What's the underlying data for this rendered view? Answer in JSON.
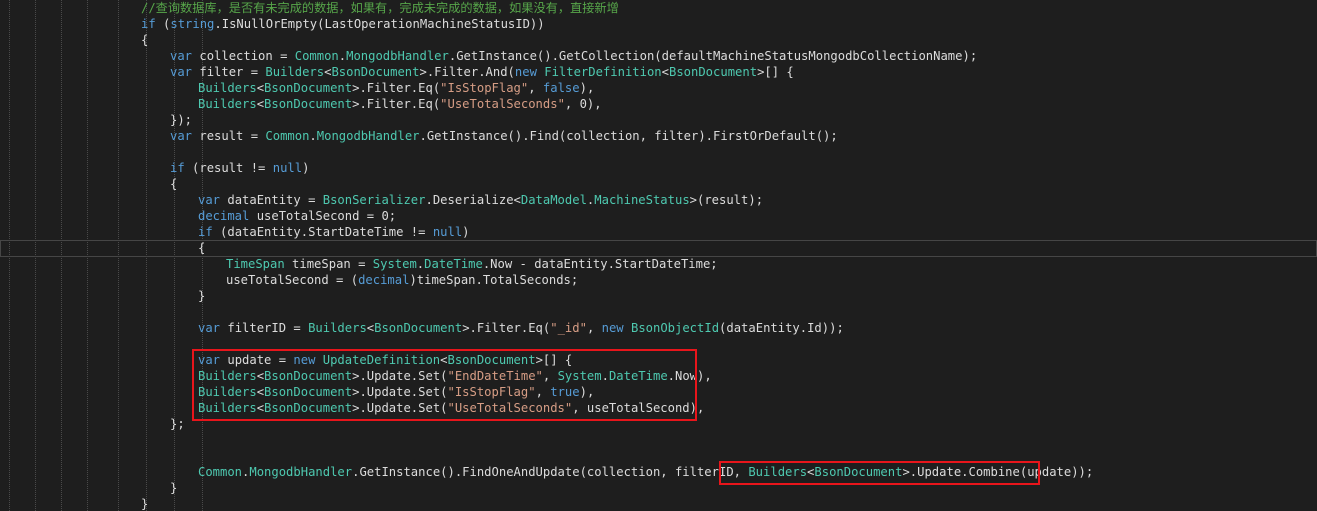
{
  "colors": {
    "background": "#1e1e1e",
    "text": "#dcdcdc",
    "keyword": "#569cd6",
    "type": "#4ec9b0",
    "string": "#d69d85",
    "comment": "#57a64a",
    "highlight_box": "#e8151b",
    "current_line_border": "#464646"
  },
  "code_lines": [
    {
      "indent": 5,
      "tokens": [
        [
          "cm",
          "//查询数据库，是否有未完成的数据，如果有，完成未完成的数据，如果没有，直接新增"
        ]
      ]
    },
    {
      "indent": 5,
      "tokens": [
        [
          "kw",
          "if"
        ],
        [
          "tx",
          " ("
        ],
        [
          "kw",
          "string"
        ],
        [
          "tx",
          "."
        ],
        [
          "tx",
          "IsNullOrEmpty(LastOperationMachineStatusID))"
        ]
      ]
    },
    {
      "indent": 5,
      "tokens": [
        [
          "tx",
          "{"
        ]
      ]
    },
    {
      "indent": 6,
      "tokens": [
        [
          "kw",
          "var"
        ],
        [
          "tx",
          " collection = "
        ],
        [
          "ty",
          "Common"
        ],
        [
          "tx",
          "."
        ],
        [
          "ty",
          "MongodbHandler"
        ],
        [
          "tx",
          ".GetInstance().GetCollection(defaultMachineStatusMongodbCollectionName);"
        ]
      ]
    },
    {
      "indent": 6,
      "tokens": [
        [
          "kw",
          "var"
        ],
        [
          "tx",
          " filter = "
        ],
        [
          "ty",
          "Builders"
        ],
        [
          "tx",
          "<"
        ],
        [
          "ty",
          "BsonDocument"
        ],
        [
          "tx",
          ">.Filter.And("
        ],
        [
          "kw",
          "new"
        ],
        [
          "tx",
          " "
        ],
        [
          "ty",
          "FilterDefinition"
        ],
        [
          "tx",
          "<"
        ],
        [
          "ty",
          "BsonDocument"
        ],
        [
          "tx",
          ">[] {"
        ]
      ]
    },
    {
      "indent": 7,
      "tokens": [
        [
          "ty",
          "Builders"
        ],
        [
          "tx",
          "<"
        ],
        [
          "ty",
          "BsonDocument"
        ],
        [
          "tx",
          ">.Filter.Eq("
        ],
        [
          "st",
          "\"IsStopFlag\""
        ],
        [
          "tx",
          ", "
        ],
        [
          "kw",
          "false"
        ],
        [
          "tx",
          "),"
        ]
      ]
    },
    {
      "indent": 7,
      "tokens": [
        [
          "ty",
          "Builders"
        ],
        [
          "tx",
          "<"
        ],
        [
          "ty",
          "BsonDocument"
        ],
        [
          "tx",
          ">.Filter.Eq("
        ],
        [
          "st",
          "\"UseTotalSeconds\""
        ],
        [
          "tx",
          ", 0),"
        ]
      ]
    },
    {
      "indent": 6,
      "tokens": [
        [
          "tx",
          "});"
        ]
      ]
    },
    {
      "indent": 6,
      "tokens": [
        [
          "kw",
          "var"
        ],
        [
          "tx",
          " result = "
        ],
        [
          "ty",
          "Common"
        ],
        [
          "tx",
          "."
        ],
        [
          "ty",
          "MongodbHandler"
        ],
        [
          "tx",
          ".GetInstance().Find(collection, filter).FirstOrDefault();"
        ]
      ]
    },
    {
      "indent": 6,
      "tokens": []
    },
    {
      "indent": 6,
      "tokens": [
        [
          "kw",
          "if"
        ],
        [
          "tx",
          " (result != "
        ],
        [
          "kw",
          "null"
        ],
        [
          "tx",
          ")"
        ]
      ]
    },
    {
      "indent": 6,
      "tokens": [
        [
          "tx",
          "{"
        ]
      ]
    },
    {
      "indent": 7,
      "tokens": [
        [
          "kw",
          "var"
        ],
        [
          "tx",
          " dataEntity = "
        ],
        [
          "ty",
          "BsonSerializer"
        ],
        [
          "tx",
          ".Deserialize<"
        ],
        [
          "ty",
          "DataModel"
        ],
        [
          "tx",
          "."
        ],
        [
          "ty",
          "MachineStatus"
        ],
        [
          "tx",
          ">(result);"
        ]
      ]
    },
    {
      "indent": 7,
      "tokens": [
        [
          "kw",
          "decimal"
        ],
        [
          "tx",
          " useTotalSecond = 0;"
        ]
      ]
    },
    {
      "indent": 7,
      "tokens": [
        [
          "kw",
          "if"
        ],
        [
          "tx",
          " (dataEntity.StartDateTime != "
        ],
        [
          "kw",
          "null"
        ],
        [
          "tx",
          ")"
        ]
      ]
    },
    {
      "indent": 7,
      "tokens": [
        [
          "tx",
          "{"
        ]
      ]
    },
    {
      "indent": 8,
      "tokens": [
        [
          "ty",
          "TimeSpan"
        ],
        [
          "tx",
          " timeSpan = "
        ],
        [
          "ty",
          "System"
        ],
        [
          "tx",
          "."
        ],
        [
          "ty",
          "DateTime"
        ],
        [
          "tx",
          ".Now - dataEntity.StartDateTime;"
        ]
      ]
    },
    {
      "indent": 8,
      "tokens": [
        [
          "tx",
          "useTotalSecond = ("
        ],
        [
          "kw",
          "decimal"
        ],
        [
          "tx",
          ")timeSpan.TotalSeconds;"
        ]
      ]
    },
    {
      "indent": 7,
      "tokens": [
        [
          "tx",
          "}"
        ]
      ]
    },
    {
      "indent": 7,
      "tokens": []
    },
    {
      "indent": 7,
      "tokens": [
        [
          "kw",
          "var"
        ],
        [
          "tx",
          " filterID = "
        ],
        [
          "ty",
          "Builders"
        ],
        [
          "tx",
          "<"
        ],
        [
          "ty",
          "BsonDocument"
        ],
        [
          "tx",
          ">.Filter.Eq("
        ],
        [
          "st",
          "\"_id\""
        ],
        [
          "tx",
          ", "
        ],
        [
          "kw",
          "new"
        ],
        [
          "tx",
          " "
        ],
        [
          "ty",
          "BsonObjectId"
        ],
        [
          "tx",
          "(dataEntity.Id));"
        ]
      ]
    },
    {
      "indent": 7,
      "tokens": []
    },
    {
      "indent": 7,
      "tokens": [
        [
          "kw",
          "var"
        ],
        [
          "tx",
          " update = "
        ],
        [
          "kw",
          "new"
        ],
        [
          "tx",
          " "
        ],
        [
          "ty",
          "UpdateDefinition"
        ],
        [
          "tx",
          "<"
        ],
        [
          "ty",
          "BsonDocument"
        ],
        [
          "tx",
          ">[] {"
        ]
      ]
    },
    {
      "indent": 7,
      "tokens": [
        [
          "ty",
          "Builders"
        ],
        [
          "tx",
          "<"
        ],
        [
          "ty",
          "BsonDocument"
        ],
        [
          "tx",
          ">.Update.Set("
        ],
        [
          "st",
          "\"EndDateTime\""
        ],
        [
          "tx",
          ", "
        ],
        [
          "ty",
          "System"
        ],
        [
          "tx",
          "."
        ],
        [
          "ty",
          "DateTime"
        ],
        [
          "tx",
          ".Now),"
        ]
      ]
    },
    {
      "indent": 7,
      "tokens": [
        [
          "ty",
          "Builders"
        ],
        [
          "tx",
          "<"
        ],
        [
          "ty",
          "BsonDocument"
        ],
        [
          "tx",
          ">.Update.Set("
        ],
        [
          "st",
          "\"IsStopFlag\""
        ],
        [
          "tx",
          ", "
        ],
        [
          "kw",
          "true"
        ],
        [
          "tx",
          "),"
        ]
      ]
    },
    {
      "indent": 7,
      "tokens": [
        [
          "ty",
          "Builders"
        ],
        [
          "tx",
          "<"
        ],
        [
          "ty",
          "BsonDocument"
        ],
        [
          "tx",
          ">.Update.Set("
        ],
        [
          "st",
          "\"UseTotalSeconds\""
        ],
        [
          "tx",
          ", useTotalSecond),"
        ]
      ]
    },
    {
      "indent": 6,
      "tokens": [
        [
          "tx",
          "};"
        ]
      ]
    },
    {
      "indent": 7,
      "tokens": []
    },
    {
      "indent": 7,
      "tokens": []
    },
    {
      "indent": 7,
      "tokens": [
        [
          "ty",
          "Common"
        ],
        [
          "tx",
          "."
        ],
        [
          "ty",
          "MongodbHandler"
        ],
        [
          "tx",
          ".GetInstance().FindOneAndUpdate(collection, filterID, "
        ],
        [
          "ty",
          "Builders"
        ],
        [
          "tx",
          "<"
        ],
        [
          "ty",
          "BsonDocument"
        ],
        [
          "tx",
          ">.Update.Combine(update));"
        ]
      ]
    },
    {
      "indent": 6,
      "tokens": [
        [
          "tx",
          "}"
        ]
      ]
    },
    {
      "indent": 5,
      "tokens": [
        [
          "tx",
          "}"
        ]
      ]
    }
  ]
}
